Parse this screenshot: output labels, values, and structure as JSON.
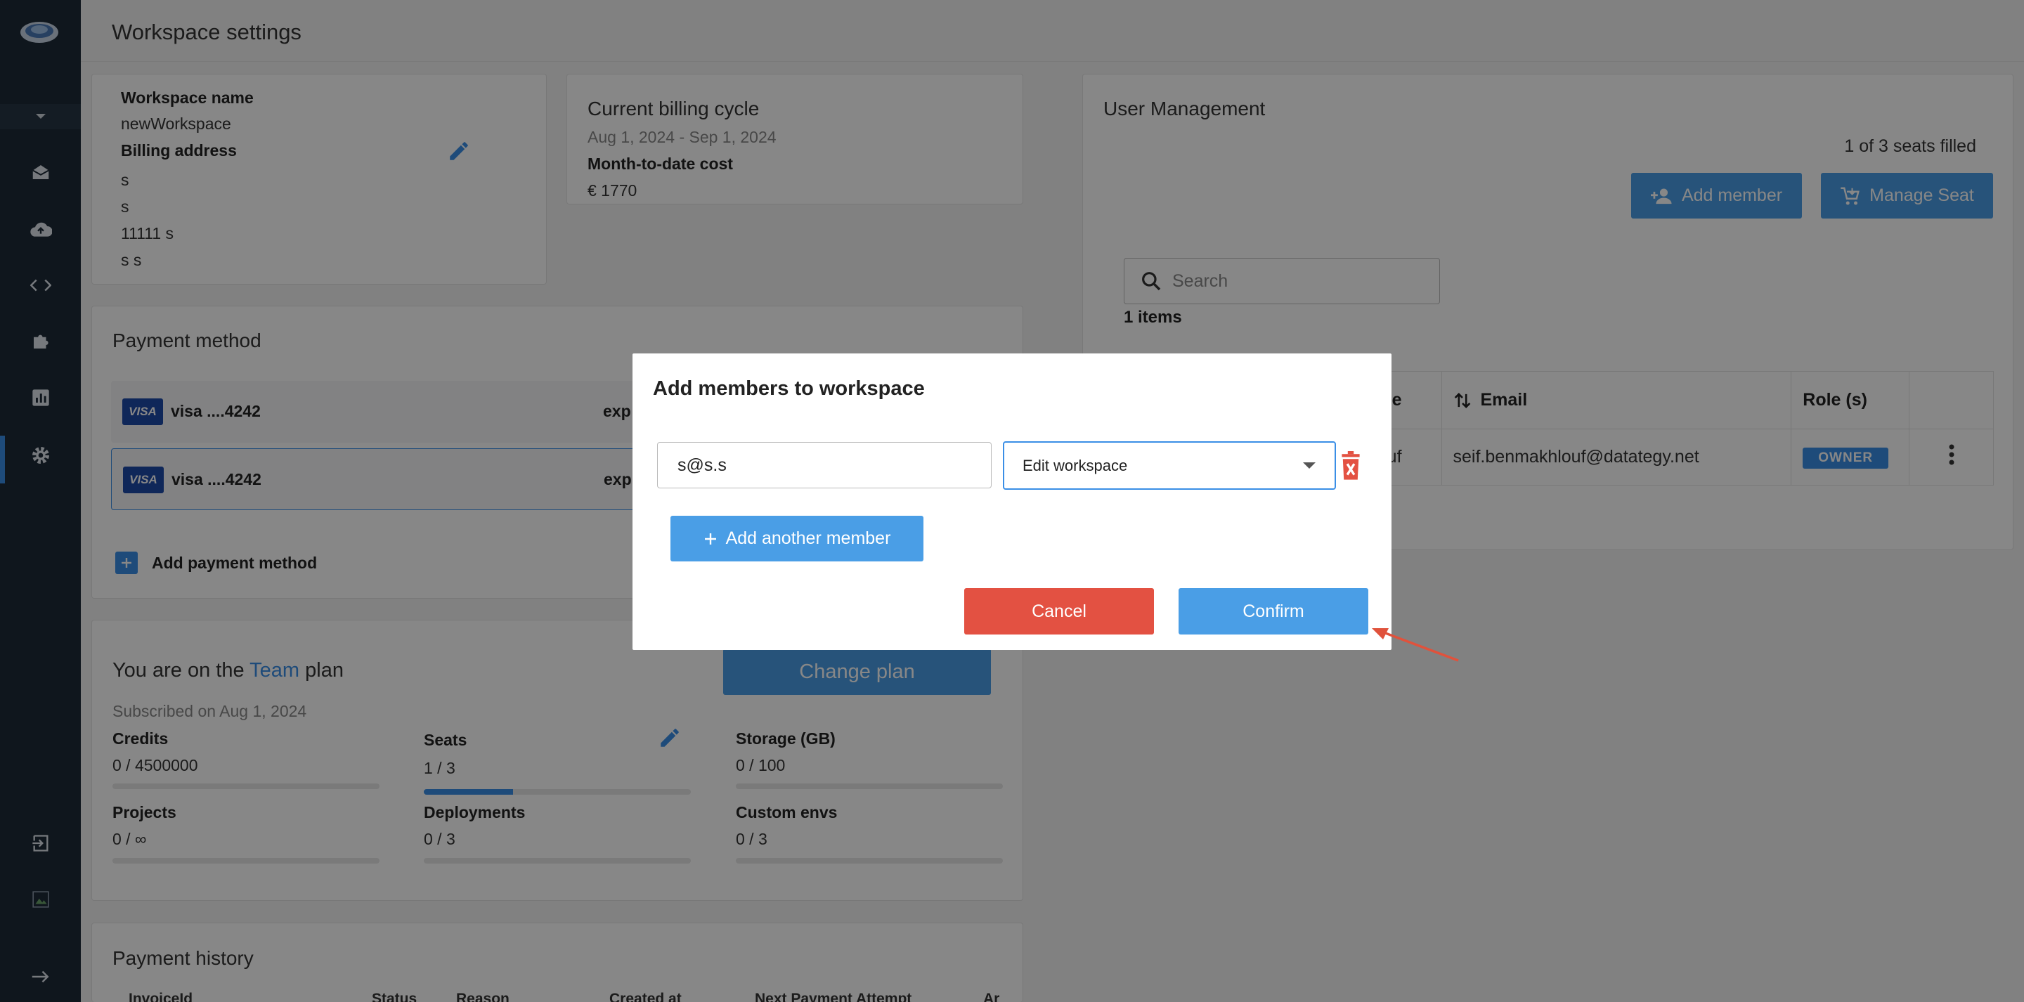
{
  "sidebar": {
    "icons": [
      "logo-icon",
      "chevron-down-icon",
      "inbox-icon",
      "cloud-upload-icon",
      "code-icon",
      "puzzle-icon",
      "chart-icon",
      "gear-icon",
      "logout-icon",
      "broken-image-icon",
      "arrow-right-icon"
    ]
  },
  "header": {
    "title": "Workspace settings"
  },
  "workspace": {
    "name_label": "Workspace name",
    "name_value": "newWorkspace",
    "billing_label": "Billing address",
    "address_lines": [
      "s",
      "s",
      "11111 s",
      "s s"
    ]
  },
  "billing": {
    "title": "Current billing cycle",
    "period": "Aug 1, 2024 - Sep 1, 2024",
    "cost_label": "Month-to-date cost",
    "cost_value": "€ 1770"
  },
  "payment": {
    "title": "Payment method",
    "cards": [
      {
        "brand": "VISA",
        "number": "visa ....4242",
        "exp_label": "exp"
      },
      {
        "brand": "VISA",
        "number": "visa ....4242",
        "exp_label": "exp"
      }
    ],
    "add_label": "Add payment method"
  },
  "plan": {
    "prefix": "You are on the",
    "name": "Team",
    "suffix": "plan",
    "change_button": "Change plan",
    "subscribed": "Subscribed on Aug 1, 2024",
    "metrics": [
      {
        "label": "Credits",
        "value": "0 / 4500000",
        "progress": 0
      },
      {
        "label": "Seats",
        "value": "1 / 3",
        "progress": 0.333
      },
      {
        "label": "Storage (GB)",
        "value": "0 / 100",
        "progress": 0
      },
      {
        "label": "Projects",
        "value": "0 / ∞",
        "progress": 0
      },
      {
        "label": "Deployments",
        "value": "0 / 3",
        "progress": 0
      },
      {
        "label": "Custom envs",
        "value": "0 / 3",
        "progress": 0
      }
    ]
  },
  "history": {
    "title": "Payment history",
    "columns": [
      "InvoiceId",
      "Status",
      "Reason",
      "Created at",
      "Next Payment Attempt",
      "Ar"
    ]
  },
  "users": {
    "title": "User Management",
    "seats": "1 of 3 seats filled",
    "add_member": "Add member",
    "manage_seat": "Manage Seat",
    "search_placeholder": "Search",
    "items_count": "1 items",
    "columns": [
      "ame",
      "Email",
      "Role (s)"
    ],
    "rows": [
      {
        "name": "uf",
        "email": "seif.benmakhlouf@datategy.net",
        "role": "OWNER"
      }
    ]
  },
  "modal": {
    "title": "Add members to workspace",
    "email_value": "s@s.s",
    "role_value": "Edit workspace",
    "add_another": "Add another member",
    "cancel": "Cancel",
    "confirm": "Confirm"
  },
  "colors": {
    "accent": "#4a9ee6",
    "danger": "#e35142",
    "sidebar": "#1d2a38",
    "annotation_arrow": "#e0523c"
  }
}
